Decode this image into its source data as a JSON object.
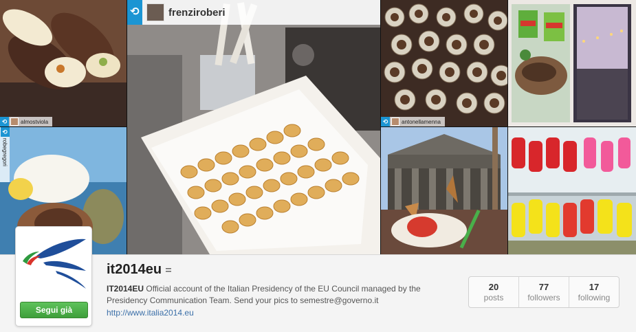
{
  "mosaic": {
    "tiles": [
      {
        "id": "cannoli",
        "credit": "almostviola"
      },
      {
        "id": "tortellini",
        "credit": "frenziroberi"
      },
      {
        "id": "shellfish",
        "credit": "antonellamenna"
      },
      {
        "id": "dinner",
        "credit": ""
      },
      {
        "id": "gelato",
        "credit": "robegregori"
      },
      {
        "id": "pantheon",
        "credit": ""
      },
      {
        "id": "ghiaccioli",
        "credit": ""
      }
    ],
    "featured_user": "frenziroberi"
  },
  "profile": {
    "username": "it2014eu",
    "follow_label": "Segui già",
    "bio_name": "IT2014EU",
    "bio_text": " Official account of the Italian Presidency of the EU Council managed by the Presidency Communication Team. Send your pics to semestre@governo.it",
    "website": "http://www.italia2014.eu",
    "stats": [
      {
        "value": "20",
        "label": "posts"
      },
      {
        "value": "77",
        "label": "followers"
      },
      {
        "value": "17",
        "label": "following"
      }
    ]
  },
  "colors": {
    "regram_blue": "#1b95d3",
    "follow_green": "#4cae48",
    "link_blue": "#3b6fa8"
  }
}
